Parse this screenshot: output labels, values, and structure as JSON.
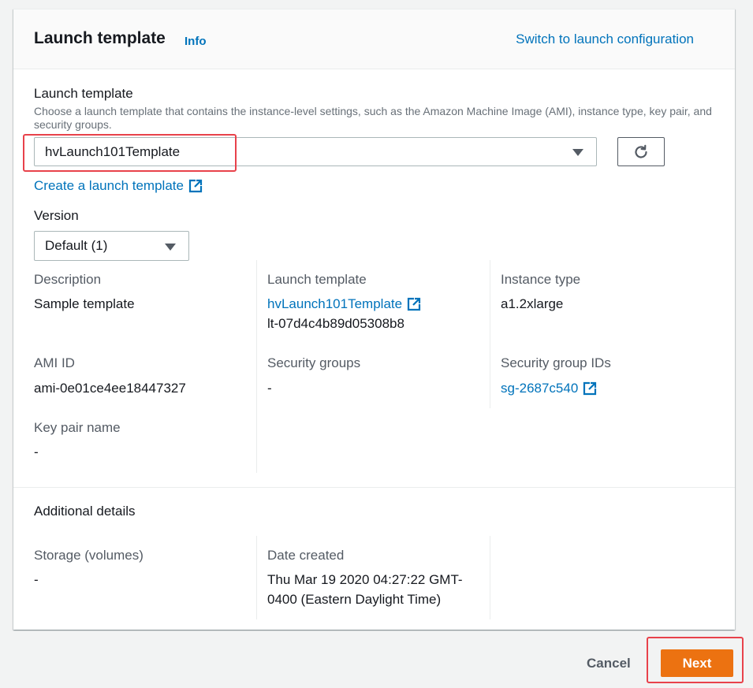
{
  "header": {
    "title": "Launch template",
    "info_label": "Info",
    "switch_link": "Switch to launch configuration"
  },
  "template_field": {
    "label": "Launch template",
    "description": "Choose a launch template that contains the instance-level settings, such as the Amazon Machine Image (AMI), instance type, key pair, and security groups.",
    "selected_value": "hvLaunch101Template",
    "create_link": "Create a launch template"
  },
  "version_field": {
    "label": "Version",
    "selected_value": "Default (1)"
  },
  "details": {
    "description_label": "Description",
    "description_value": "Sample template",
    "launch_template_label": "Launch template",
    "launch_template_link": "hvLaunch101Template",
    "launch_template_id": "lt-07d4c4b89d05308b8",
    "instance_type_label": "Instance type",
    "instance_type_value": "a1.2xlarge",
    "ami_id_label": "AMI ID",
    "ami_id_value": "ami-0e01ce4ee18447327",
    "security_groups_label": "Security groups",
    "security_groups_value": "-",
    "security_group_ids_label": "Security group IDs",
    "security_group_ids_link": "sg-2687c540",
    "key_pair_label": "Key pair name",
    "key_pair_value": "-"
  },
  "additional_details": {
    "heading": "Additional details",
    "storage_label": "Storage (volumes)",
    "storage_value": "-",
    "date_created_label": "Date created",
    "date_created_line1": "Thu Mar 19 2020 04:27:22 GMT-",
    "date_created_line2": "0400 (Eastern Daylight Time)"
  },
  "footer": {
    "cancel_label": "Cancel",
    "next_label": "Next"
  },
  "colors": {
    "link": "#0073bb",
    "primary_button": "#ec7211",
    "highlight": "#e8424b"
  }
}
